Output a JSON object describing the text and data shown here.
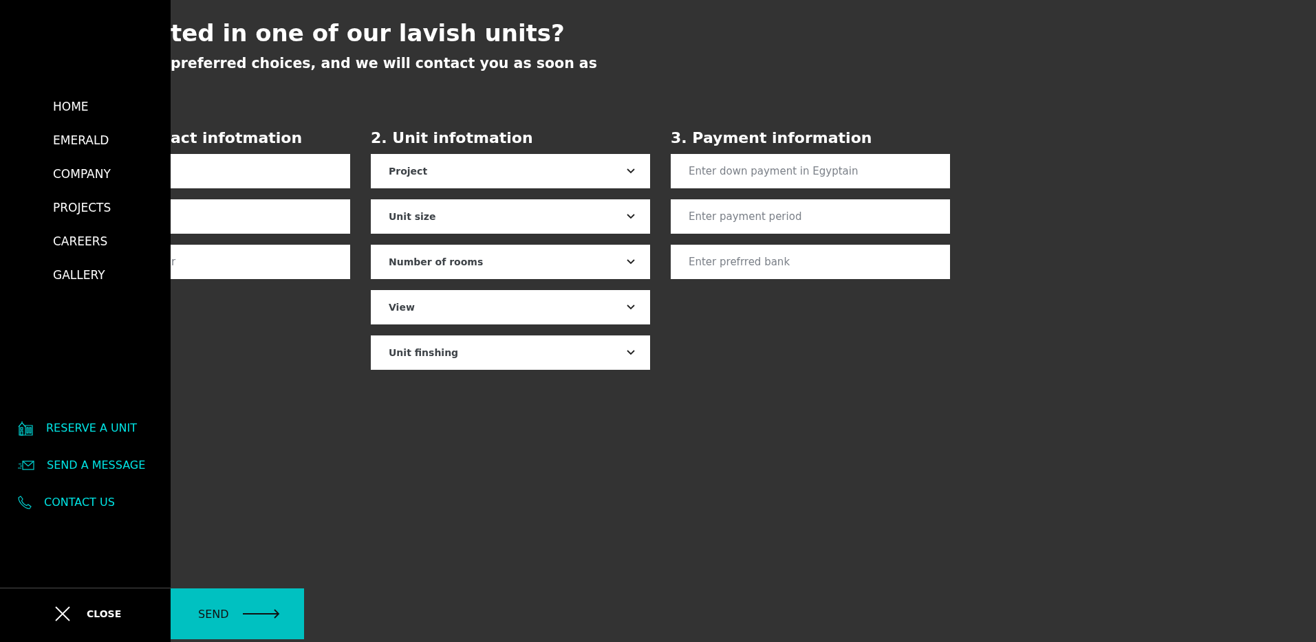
{
  "sidebar": {
    "nav": [
      {
        "label": "HOME"
      },
      {
        "label": "EMERALD"
      },
      {
        "label": "COMPANY"
      },
      {
        "label": "PROJECTS"
      },
      {
        "label": "CAREERS"
      },
      {
        "label": "GALLERY"
      }
    ],
    "actions": [
      {
        "kind": "building",
        "label": "RESERVE A UNIT"
      },
      {
        "kind": "mail",
        "label": "SEND A MESSAGE"
      },
      {
        "kind": "phone",
        "label": "CONTACT US"
      }
    ],
    "close_button": {
      "label": "CLOSE"
    }
  },
  "header": {
    "title": "ted in one of our lavish units?",
    "subtitle": "preferred choices, and we will contact you as soon as"
  },
  "sections": [
    {
      "title": "act infotmation",
      "fields": [
        {
          "kind": "input"
        },
        {
          "kind": "input"
        },
        {
          "kind": "input",
          "placeholder": "r"
        }
      ]
    },
    {
      "number": "2.",
      "title": "Unit infotmation",
      "fields": [
        {
          "kind": "select",
          "label": "Project"
        },
        {
          "kind": "select",
          "label": "Unit size"
        },
        {
          "kind": "select",
          "label": "Number of rooms"
        },
        {
          "kind": "select",
          "label": "View"
        },
        {
          "kind": "select",
          "label": "Unit finshing"
        }
      ]
    },
    {
      "number": "3.",
      "title": "Payment information",
      "fields": [
        {
          "kind": "input",
          "placeholder": "Enter down payment in Egyptain"
        },
        {
          "kind": "input",
          "placeholder": "Enter payment period"
        },
        {
          "kind": "input",
          "placeholder": "Enter prefrred bank"
        }
      ]
    }
  ],
  "send_button": {
    "label": "SEND"
  }
}
